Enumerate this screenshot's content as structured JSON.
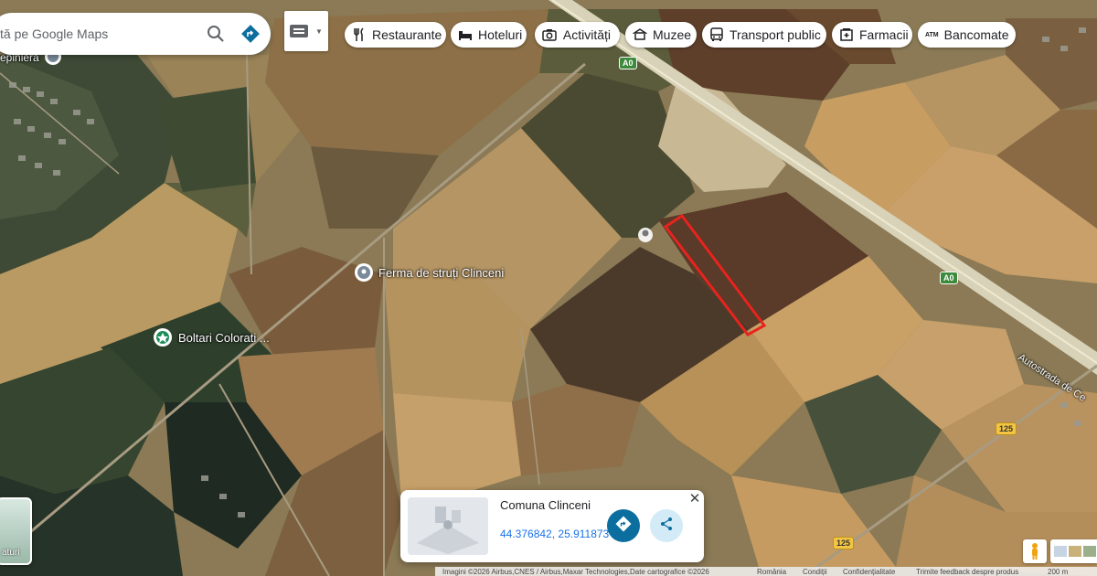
{
  "search": {
    "placeholder": "tă pe Google Maps",
    "search_icon": "search-icon",
    "directions_icon": "directions-icon"
  },
  "keyboard": {
    "icon": "keyboard-icon",
    "dropdown_icon": "caret-down-icon"
  },
  "categories": [
    {
      "label": "Restaurante",
      "icon": "fork-knife-icon"
    },
    {
      "label": "Hoteluri",
      "icon": "bed-icon"
    },
    {
      "label": "Activități",
      "icon": "camera-icon"
    },
    {
      "label": "Muzee",
      "icon": "museum-icon"
    },
    {
      "label": "Transport public",
      "icon": "bus-icon"
    },
    {
      "label": "Farmacii",
      "icon": "pharmacy-icon"
    },
    {
      "label": "Bancomate",
      "icon": "atm-icon"
    }
  ],
  "map_labels": {
    "pepiniera": "epinieră",
    "ferma": "Ferma de struți Clinceni",
    "boltari": "Boltari Colorati ...",
    "autostrada": "Autostrada de Ce",
    "road_a0_1": "A0",
    "road_a0_2": "A0",
    "road_125_1": "125",
    "road_125_2": "125"
  },
  "info_card": {
    "title": "Comuna Clinceni",
    "coordinates": "44.376842, 25.911873",
    "close": "✕",
    "directions_icon": "directions-icon",
    "share_icon": "share-icon"
  },
  "layers": {
    "label": "aturi"
  },
  "footer": {
    "imagery": "Imagini ©2026 Airbus,CNES / Airbus,Maxar Technologies,Date cartografice ©2026",
    "country": "România",
    "terms": "Condiții",
    "privacy": "Confidențialitate",
    "feedback": "Trimite feedback despre produs",
    "scale": "200 m"
  },
  "colors": {
    "selection_outline": "#e8231e",
    "directions_button": "#0b6e9e",
    "link": "#1a73e8"
  }
}
